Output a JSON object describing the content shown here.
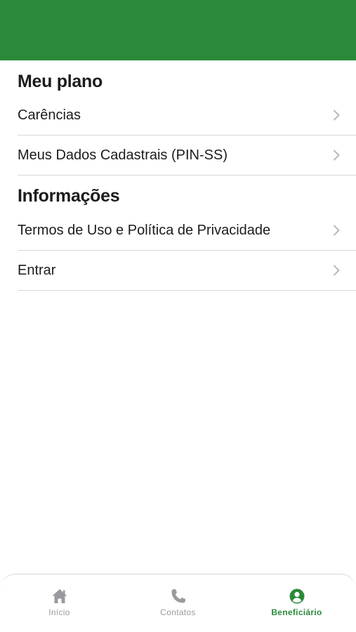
{
  "theme": {
    "header_color": "#2b8a3a",
    "active_tab_color": "#2b8a3a",
    "inactive_tab_color": "#9a9a9f"
  },
  "sections": [
    {
      "title": "Meu plano",
      "items": [
        {
          "label": "Carências",
          "icon": "chevron-right-icon"
        },
        {
          "label": "Meus Dados Cadastrais (PIN-SS)",
          "icon": "chevron-right-icon"
        }
      ]
    },
    {
      "title": "Informações",
      "items": [
        {
          "label": "Termos de Uso e Política de Privacidade",
          "icon": "chevron-right-icon"
        },
        {
          "label": "Entrar",
          "icon": "chevron-right-icon"
        }
      ]
    }
  ],
  "tabbar": {
    "tabs": [
      {
        "label": "Início",
        "icon": "home-icon",
        "active": false
      },
      {
        "label": "Contatos",
        "icon": "phone-icon",
        "active": false
      },
      {
        "label": "Beneficiário",
        "icon": "user-circle-icon",
        "active": true
      }
    ]
  }
}
